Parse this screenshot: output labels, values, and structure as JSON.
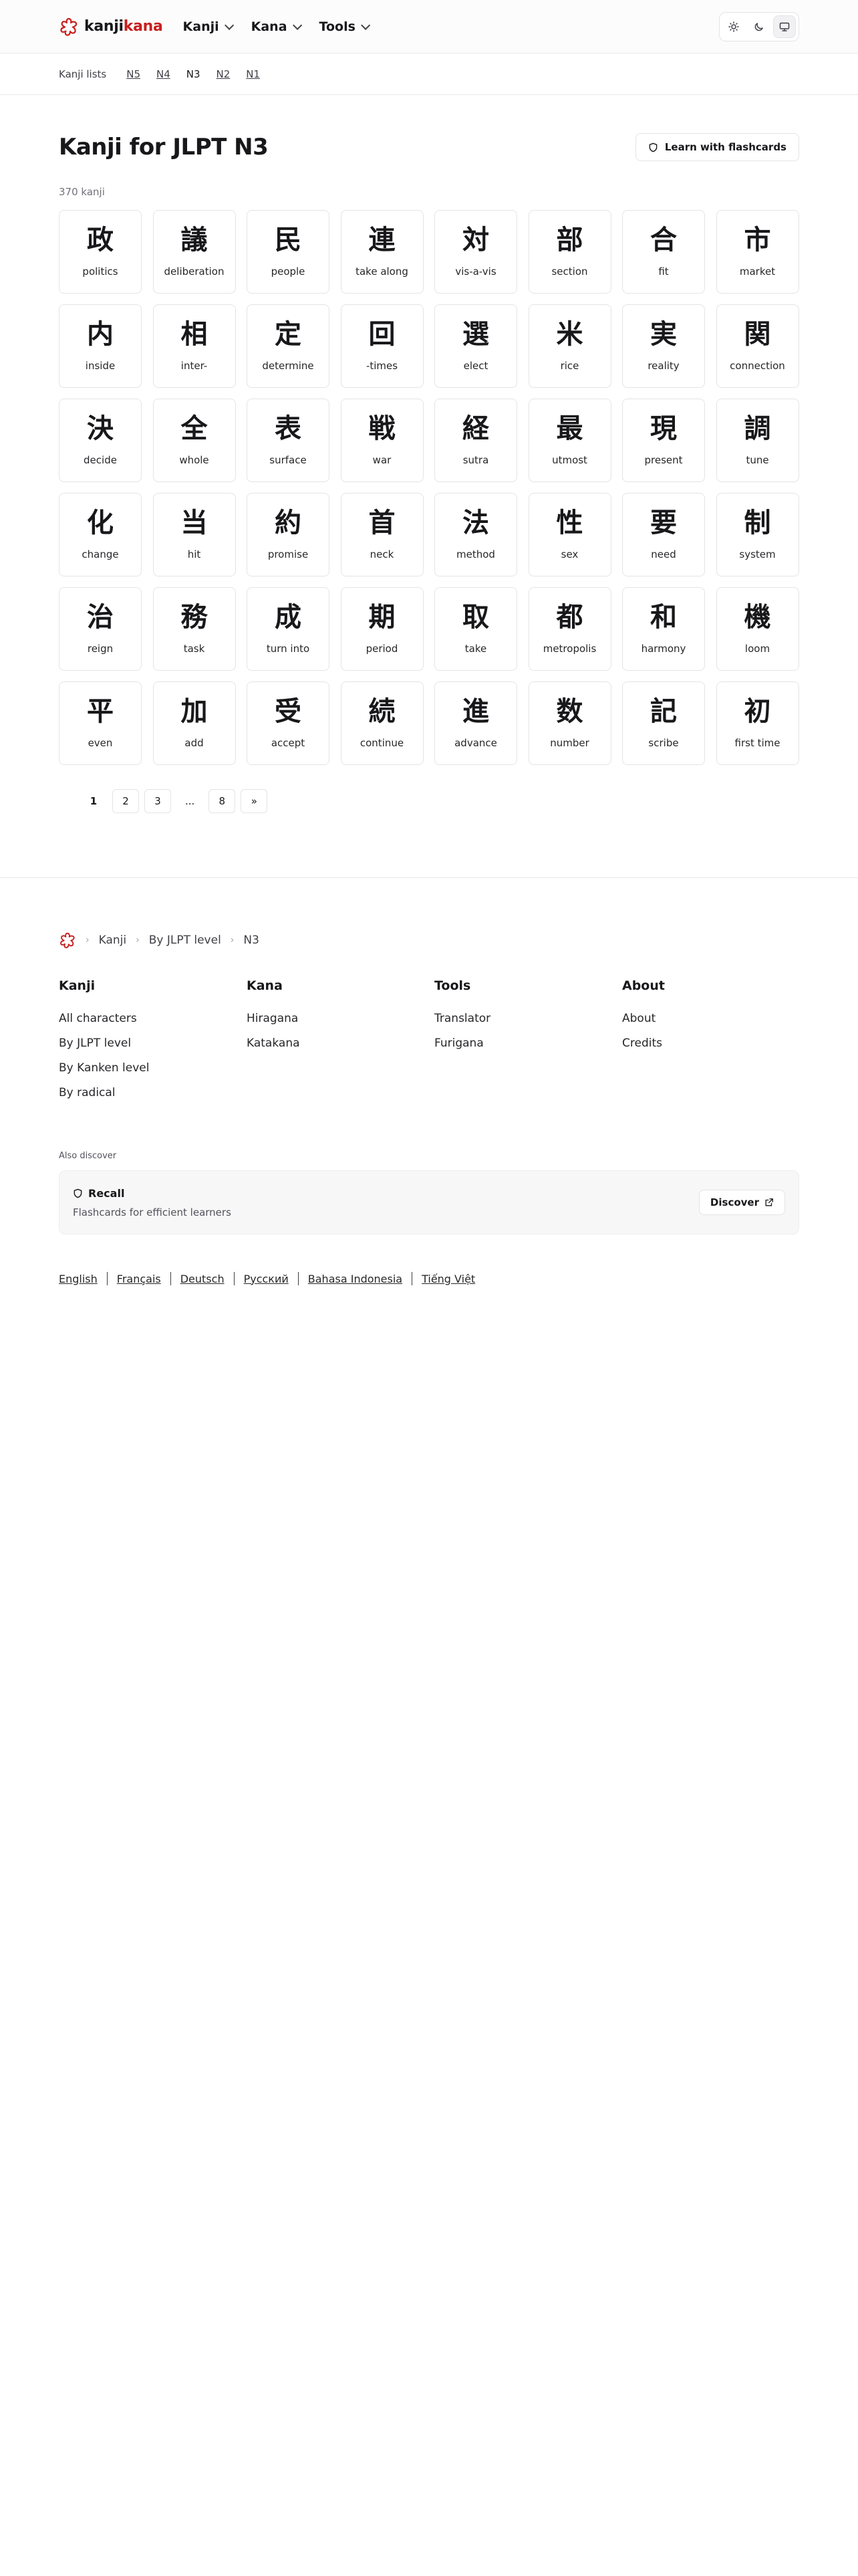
{
  "header": {
    "logo_part1": "kanji",
    "logo_part2": "kana",
    "nav": [
      "Kanji",
      "Kana",
      "Tools"
    ]
  },
  "subnav": {
    "label": "Kanji lists",
    "levels": [
      {
        "label": "N5",
        "current": false
      },
      {
        "label": "N4",
        "current": false
      },
      {
        "label": "N3",
        "current": true
      },
      {
        "label": "N2",
        "current": false
      },
      {
        "label": "N1",
        "current": false
      }
    ]
  },
  "main": {
    "title": "Kanji for JLPT N3",
    "flashcards_label": "Learn with flashcards",
    "count": "370 kanji",
    "kanji": [
      {
        "char": "政",
        "meaning": "politics"
      },
      {
        "char": "議",
        "meaning": "deliberation"
      },
      {
        "char": "民",
        "meaning": "people"
      },
      {
        "char": "連",
        "meaning": "take along"
      },
      {
        "char": "対",
        "meaning": "vis-a-vis"
      },
      {
        "char": "部",
        "meaning": "section"
      },
      {
        "char": "合",
        "meaning": "fit"
      },
      {
        "char": "市",
        "meaning": "market"
      },
      {
        "char": "内",
        "meaning": "inside"
      },
      {
        "char": "相",
        "meaning": "inter-"
      },
      {
        "char": "定",
        "meaning": "determine"
      },
      {
        "char": "回",
        "meaning": "-times"
      },
      {
        "char": "選",
        "meaning": "elect"
      },
      {
        "char": "米",
        "meaning": "rice"
      },
      {
        "char": "実",
        "meaning": "reality"
      },
      {
        "char": "関",
        "meaning": "connection"
      },
      {
        "char": "決",
        "meaning": "decide"
      },
      {
        "char": "全",
        "meaning": "whole"
      },
      {
        "char": "表",
        "meaning": "surface"
      },
      {
        "char": "戦",
        "meaning": "war"
      },
      {
        "char": "経",
        "meaning": "sutra"
      },
      {
        "char": "最",
        "meaning": "utmost"
      },
      {
        "char": "現",
        "meaning": "present"
      },
      {
        "char": "調",
        "meaning": "tune"
      },
      {
        "char": "化",
        "meaning": "change"
      },
      {
        "char": "当",
        "meaning": "hit"
      },
      {
        "char": "約",
        "meaning": "promise"
      },
      {
        "char": "首",
        "meaning": "neck"
      },
      {
        "char": "法",
        "meaning": "method"
      },
      {
        "char": "性",
        "meaning": "sex"
      },
      {
        "char": "要",
        "meaning": "need"
      },
      {
        "char": "制",
        "meaning": "system"
      },
      {
        "char": "治",
        "meaning": "reign"
      },
      {
        "char": "務",
        "meaning": "task"
      },
      {
        "char": "成",
        "meaning": "turn into"
      },
      {
        "char": "期",
        "meaning": "period"
      },
      {
        "char": "取",
        "meaning": "take"
      },
      {
        "char": "都",
        "meaning": "metropolis"
      },
      {
        "char": "和",
        "meaning": "harmony"
      },
      {
        "char": "機",
        "meaning": "loom"
      },
      {
        "char": "平",
        "meaning": "even"
      },
      {
        "char": "加",
        "meaning": "add"
      },
      {
        "char": "受",
        "meaning": "accept"
      },
      {
        "char": "続",
        "meaning": "continue"
      },
      {
        "char": "進",
        "meaning": "advance"
      },
      {
        "char": "数",
        "meaning": "number"
      },
      {
        "char": "記",
        "meaning": "scribe"
      },
      {
        "char": "初",
        "meaning": "first time"
      }
    ],
    "pagination": [
      {
        "label": "1",
        "type": "active"
      },
      {
        "label": "2",
        "type": "page"
      },
      {
        "label": "3",
        "type": "page"
      },
      {
        "label": "...",
        "type": "dots"
      },
      {
        "label": "8",
        "type": "page"
      },
      {
        "label": "»",
        "type": "page"
      }
    ]
  },
  "footer": {
    "breadcrumb": [
      "Kanji",
      "By JLPT level",
      "N3"
    ],
    "columns": [
      {
        "title": "Kanji",
        "links": [
          "All characters",
          "By JLPT level",
          "By Kanken level",
          "By radical"
        ]
      },
      {
        "title": "Kana",
        "links": [
          "Hiragana",
          "Katakana"
        ]
      },
      {
        "title": "Tools",
        "links": [
          "Translator",
          "Furigana"
        ]
      },
      {
        "title": "About",
        "links": [
          "About",
          "Credits"
        ]
      }
    ],
    "also_discover": "Also discover",
    "recall_name": "Recall",
    "recall_desc": "Flashcards for efficient learners",
    "discover_label": "Discover",
    "languages": [
      "English",
      "Français",
      "Deutsch",
      "Русский",
      "Bahasa Indonesia",
      "Tiếng Việt"
    ]
  },
  "colors": {
    "brand": "#c81e1e",
    "text": "#18181b",
    "border": "#e4e4e7"
  }
}
